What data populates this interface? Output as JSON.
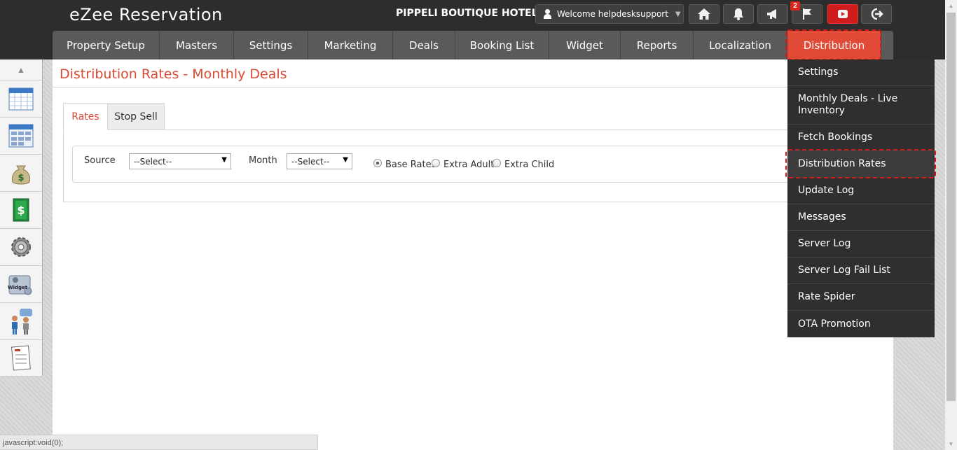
{
  "header": {
    "app_title": "eZee Reservation",
    "hotel_name": "PIPPELI BOUTIQUE HOTEL",
    "welcome_text": "Welcome helpdesksupport",
    "notification_count": "2",
    "icons": [
      "home-icon",
      "bell-icon",
      "megaphone-icon",
      "flag-icon",
      "youtube-icon",
      "logout-icon"
    ]
  },
  "nav": {
    "items": [
      {
        "label": "Property Setup"
      },
      {
        "label": "Masters"
      },
      {
        "label": "Settings"
      },
      {
        "label": "Marketing"
      },
      {
        "label": "Deals"
      },
      {
        "label": "Booking List"
      },
      {
        "label": "Widget"
      },
      {
        "label": "Reports"
      },
      {
        "label": "Localization"
      },
      {
        "label": "Distribution",
        "active": true
      }
    ],
    "accent_color": "#e04a36"
  },
  "sidebar": {
    "icons": [
      "calendar-icon",
      "calendar-year-icon",
      "money-bag-icon",
      "cash-icon",
      "gear-icon",
      "widget-icon",
      "users-chat-icon",
      "task-list-icon"
    ]
  },
  "main": {
    "page_title": "Distribution Rates - Monthly Deals",
    "tabs": [
      {
        "label": "Rates",
        "active": true
      },
      {
        "label": "Stop Sell",
        "active": false
      }
    ],
    "filters": {
      "source_label": "Source",
      "source_value": "--Select--",
      "month_label": "Month",
      "month_value": "--Select--",
      "radios": [
        {
          "label": "Base Rates",
          "checked": true
        },
        {
          "label": "Extra Adult",
          "checked": false
        },
        {
          "label": "Extra Child",
          "checked": false
        }
      ]
    }
  },
  "dropdown": {
    "items": [
      {
        "label": "Settings"
      },
      {
        "label": "Monthly Deals - Live Inventory"
      },
      {
        "label": "Fetch Bookings"
      },
      {
        "label": "Distribution Rates",
        "highlighted": true
      },
      {
        "label": "Update Log"
      },
      {
        "label": "Messages"
      },
      {
        "label": "Server Log"
      },
      {
        "label": "Server Log Fail List"
      },
      {
        "label": "Rate Spider"
      },
      {
        "label": "OTA Promotion"
      }
    ]
  },
  "statusbar": {
    "text": "javascript:void(0);"
  }
}
